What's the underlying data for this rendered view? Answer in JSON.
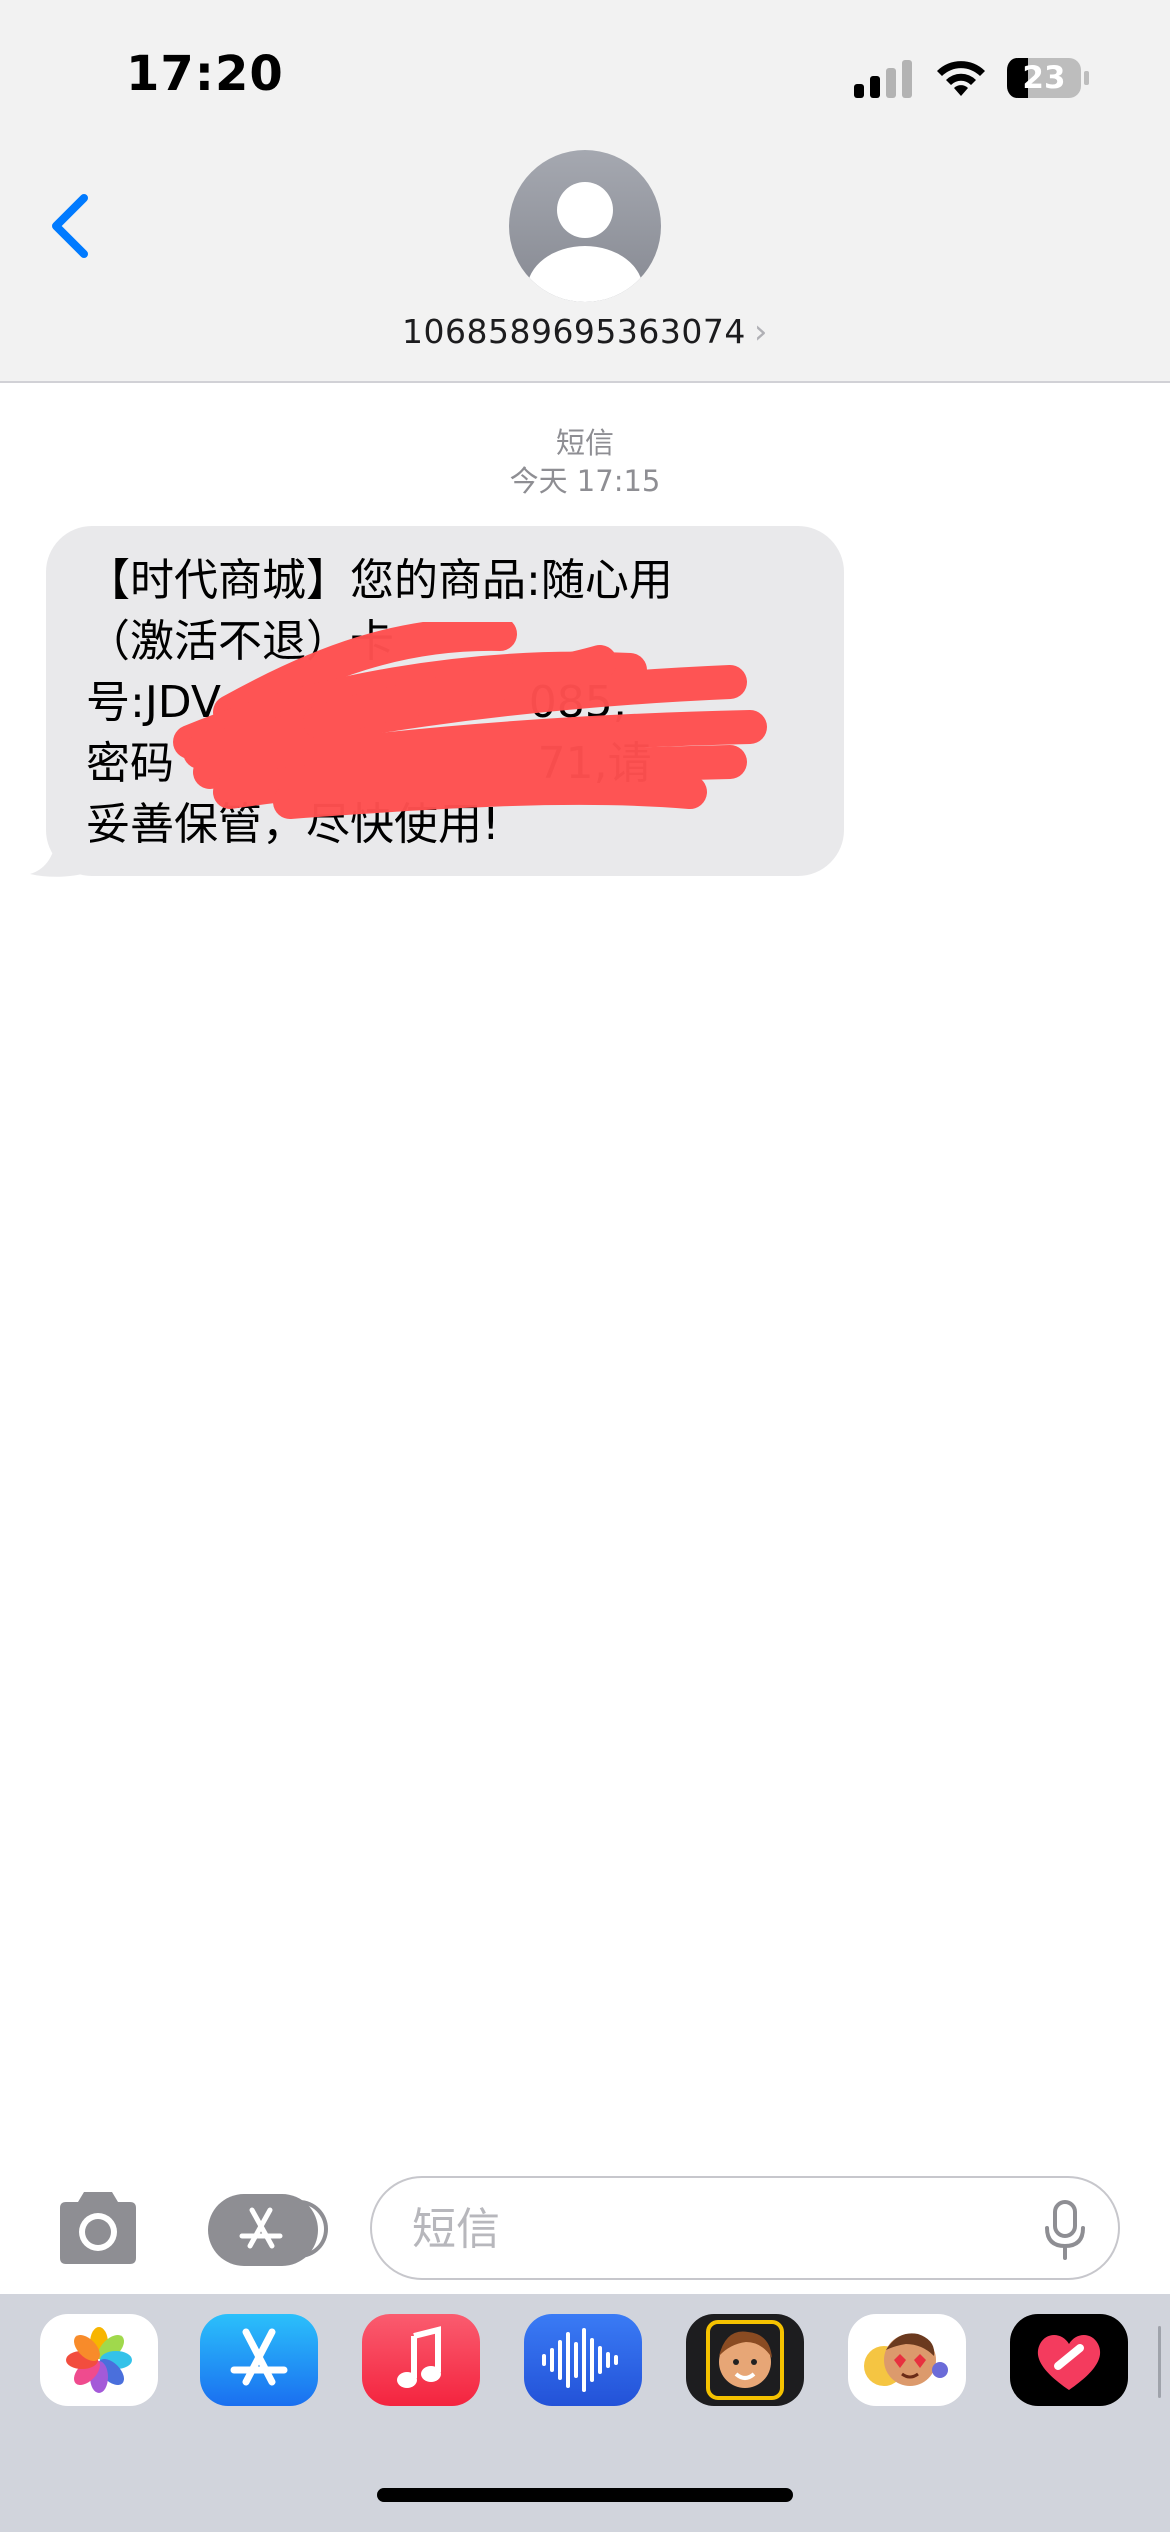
{
  "status_bar": {
    "time": "17:20",
    "battery_level": "23",
    "signal_icon": "cellular-signal-icon",
    "wifi_icon": "wifi-icon"
  },
  "header": {
    "contact_number": "1068589695363074",
    "chevron": "›"
  },
  "conversation": {
    "service_label": "短信",
    "timestamp": "今天 17:15",
    "message_lines": [
      "【时代商城】您的商品:随心用",
      "（激活不退）卡",
      "号:JDV                      085,",
      "密码                          71,请",
      "妥善保管，尽快使用!"
    ]
  },
  "compose": {
    "placeholder": "短信"
  },
  "dock": {
    "apps": [
      "photos-app-icon",
      "app-store-app-icon",
      "music-app-icon",
      "voice-memos-app-icon",
      "memoji-stickers-app-icon",
      "animoji-app-icon",
      "digital-touch-app-icon"
    ]
  },
  "colors": {
    "accent_blue": "#007aff",
    "bubble_gray": "#e9e9eb",
    "redaction_red": "#ff5050",
    "dock_gray": "#d1d4dc"
  }
}
